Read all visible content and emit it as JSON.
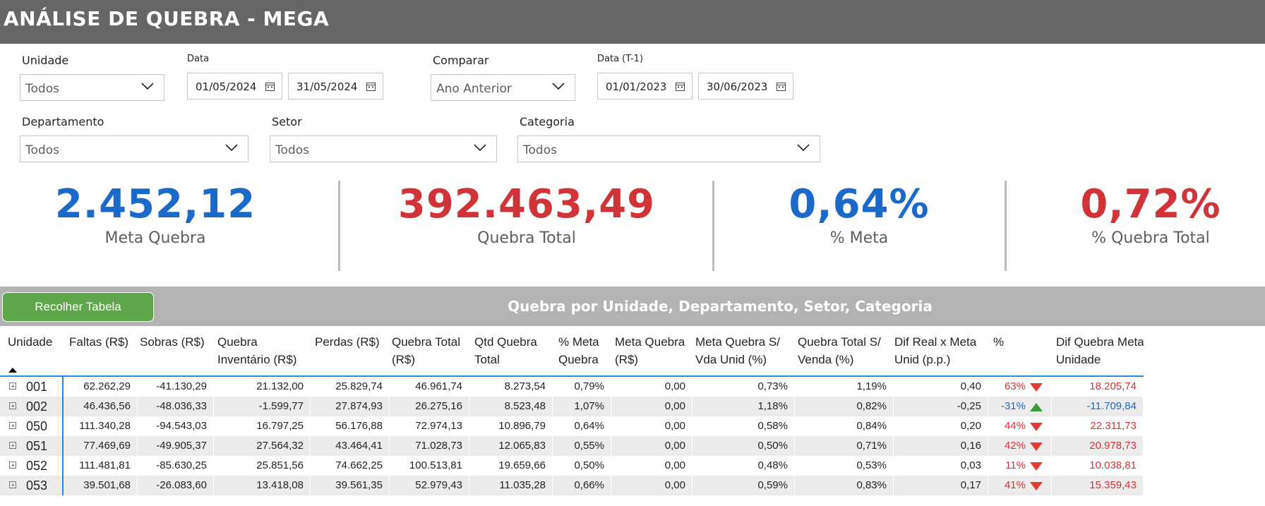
{
  "header": {
    "title": "ANÁLISE DE QUEBRA - MEGA"
  },
  "filters": {
    "unidade": {
      "label": "Unidade",
      "value": "Todos"
    },
    "data": {
      "label": "Data",
      "start": "01/05/2024",
      "end": "31/05/2024"
    },
    "comparar": {
      "label": "Comparar",
      "value": "Ano Anterior"
    },
    "data_t1": {
      "label": "Data (T-1)",
      "start": "01/01/2023",
      "end": "30/06/2023"
    },
    "departamento": {
      "label": "Departamento",
      "value": "Todos"
    },
    "setor": {
      "label": "Setor",
      "value": "Todos"
    },
    "categoria": {
      "label": "Categoria",
      "value": "Todos"
    }
  },
  "kpis": {
    "meta_quebra": {
      "value": "2.452,12",
      "label": "Meta Quebra",
      "color": "#1b6ac9"
    },
    "quebra_total": {
      "value": "392.463,49",
      "label": "Quebra Total",
      "color": "#d13438"
    },
    "pct_meta": {
      "value": "0,64%",
      "label": "% Meta",
      "color": "#1b6ac9"
    },
    "pct_quebra_total": {
      "value": "0,72%",
      "label": "% Quebra Total",
      "color": "#d13438"
    }
  },
  "table": {
    "collapse_button": "Recolher Tabela",
    "title": "Quebra por Unidade, Departamento, Setor, Categoria",
    "columns": [
      "Unidade",
      "Faltas (R$)",
      "Sobras (R$)",
      "Quebra Inventário (R$)",
      "Perdas (R$)",
      "Quebra Total (R$)",
      "Qtd Quebra Total",
      "% Meta Quebra",
      "Meta Quebra (R$)",
      "Meta Quebra S/ Vda Unid (%)",
      "Quebra Total S/ Venda (%)",
      "Dif Real x Meta Unid (p.p.)",
      "%",
      "Dif Quebra Meta Unidade"
    ],
    "rows": [
      {
        "unidade": "001",
        "faltas": "62.262,29",
        "sobras": "-41.130,29",
        "inventario": "21.132,00",
        "perdas": "25.829,74",
        "quebra_total": "46.961,74",
        "qtd": "8.273,54",
        "pct_meta": "0,79%",
        "meta_rs": "0,00",
        "meta_vda": "0,73%",
        "total_venda": "1,19%",
        "dif_pp": "0,40",
        "pct": "63%",
        "dir": "down",
        "dif_meta": "18.205,74"
      },
      {
        "unidade": "002",
        "faltas": "46.436,56",
        "sobras": "-48.036,33",
        "inventario": "-1.599,77",
        "perdas": "27.874,93",
        "quebra_total": "26.275,16",
        "qtd": "8.523,48",
        "pct_meta": "1,07%",
        "meta_rs": "0,00",
        "meta_vda": "1,18%",
        "total_venda": "0,82%",
        "dif_pp": "-0,25",
        "pct": "-31%",
        "dir": "up",
        "dif_meta": "-11.709,84"
      },
      {
        "unidade": "050",
        "faltas": "111.340,28",
        "sobras": "-94.543,03",
        "inventario": "16.797,25",
        "perdas": "56.176,88",
        "quebra_total": "72.974,13",
        "qtd": "10.896,79",
        "pct_meta": "0,64%",
        "meta_rs": "0,00",
        "meta_vda": "0,58%",
        "total_venda": "0,84%",
        "dif_pp": "0,20",
        "pct": "44%",
        "dir": "down",
        "dif_meta": "22.311,73"
      },
      {
        "unidade": "051",
        "faltas": "77.469,69",
        "sobras": "-49.905,37",
        "inventario": "27.564,32",
        "perdas": "43.464,41",
        "quebra_total": "71.028,73",
        "qtd": "12.065,83",
        "pct_meta": "0,55%",
        "meta_rs": "0,00",
        "meta_vda": "0,50%",
        "total_venda": "0,71%",
        "dif_pp": "0,16",
        "pct": "42%",
        "dir": "down",
        "dif_meta": "20.978,73"
      },
      {
        "unidade": "052",
        "faltas": "111.481,81",
        "sobras": "-85.630,25",
        "inventario": "25.851,56",
        "perdas": "74.662,25",
        "quebra_total": "100.513,81",
        "qtd": "19.659,66",
        "pct_meta": "0,50%",
        "meta_rs": "0,00",
        "meta_vda": "0,48%",
        "total_venda": "0,53%",
        "dif_pp": "0,03",
        "pct": "11%",
        "dir": "down",
        "dif_meta": "10.038,81"
      },
      {
        "unidade": "053",
        "faltas": "39.501,68",
        "sobras": "-26.083,60",
        "inventario": "13.418,08",
        "perdas": "39.561,35",
        "quebra_total": "52.979,43",
        "qtd": "11.035,28",
        "pct_meta": "0,66%",
        "meta_rs": "0,00",
        "meta_vda": "0,59%",
        "total_venda": "0,83%",
        "dif_pp": "0,17",
        "pct": "41%",
        "dir": "down",
        "dif_meta": "15.359,43"
      }
    ]
  }
}
